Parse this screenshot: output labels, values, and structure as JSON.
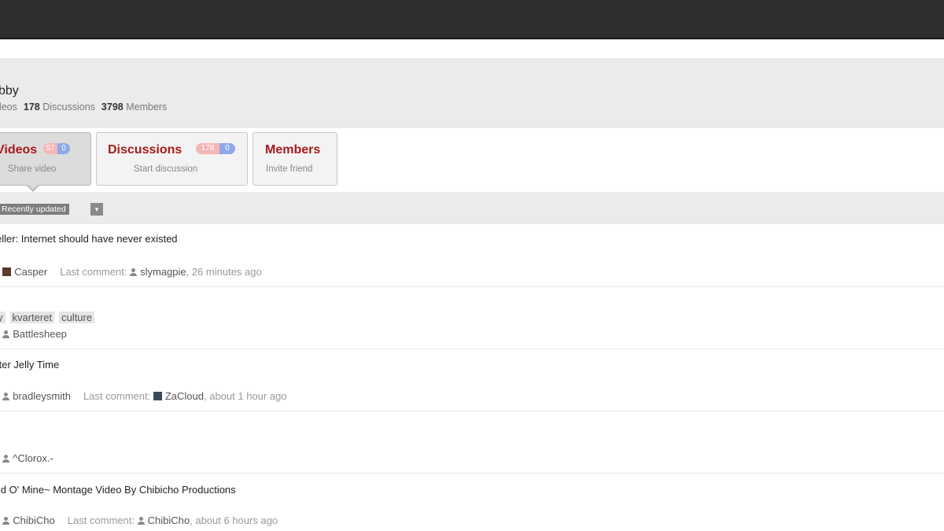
{
  "group": {
    "title": "bby",
    "stats": [
      {
        "count": "",
        "label": "ideos"
      },
      {
        "count": "178",
        "label": "Discussions"
      },
      {
        "count": "3798",
        "label": "Members"
      }
    ]
  },
  "tabs": [
    {
      "title": "Videos",
      "subtitle": "Share video",
      "badge_new": "57",
      "badge_unread": "0"
    },
    {
      "title": "Discussions",
      "subtitle": "Start discussion",
      "badge_new": "178",
      "badge_unread": "0"
    },
    {
      "title": "Members",
      "subtitle": "Invite friend"
    }
  ],
  "sort": {
    "selected": "Recently updated",
    "caret": "▾"
  },
  "items": [
    {
      "title": "eller: Internet should have never existed",
      "prefix": ":",
      "author": "Casper",
      "last_label": "Last comment:",
      "last_user": "slymagpie",
      "last_time": "26 minutes ago"
    },
    {
      "tags": [
        "y",
        "kvarteret",
        "culture"
      ],
      "prefix": ":",
      "author": "Battlesheep"
    },
    {
      "title": "tter Jelly Time",
      "prefix": ":",
      "author": "bradleysmith",
      "last_label": "Last comment:",
      "last_user": "ZaCloud",
      "last_time": "about 1 hour ago"
    },
    {
      "prefix": ":",
      "author": "^Clorox.-"
    },
    {
      "title": "ild O' Mine~ Montage Video By Chibicho Productions",
      "prefix": ":",
      "author": "ChibiCho",
      "last_label": "Last comment:",
      "last_user": "ChibiCho",
      "last_time": "about 6 hours ago"
    }
  ]
}
